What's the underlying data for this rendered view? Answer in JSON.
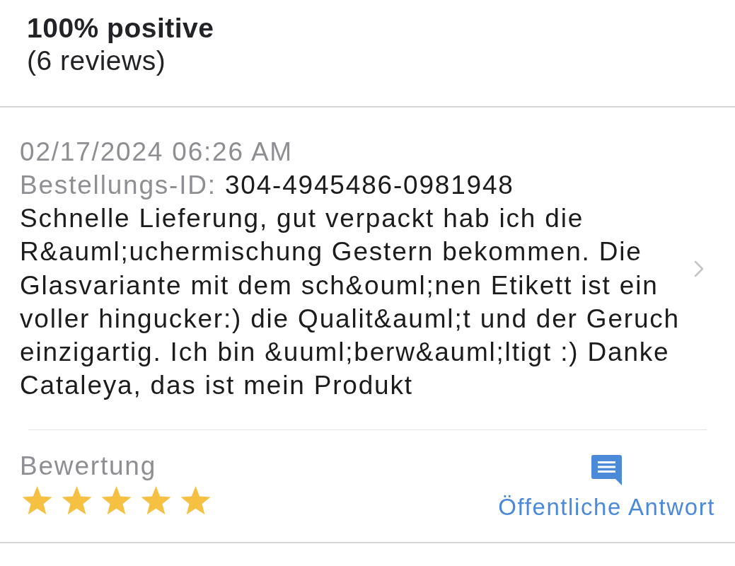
{
  "summary": {
    "rating": "100% positive",
    "count": "(6 reviews)"
  },
  "review": {
    "date": "02/17/2024 06:26 AM",
    "order_label": "Bestellungs-ID:",
    "order_id": "304-4945486-0981948",
    "text": "Schnelle Lieferung, gut verpackt hab ich die R&auml;uchermischung Gestern bekommen. Die Glasvariante mit dem sch&ouml;nen Etikett ist ein voller hingucker:) die Qualit&auml;t und der Geruch einzigartig. Ich bin &uuml;berw&auml;ltigt :) Danke Cataleya, das ist mein Produkt",
    "rating_label": "Bewertung",
    "stars": 5,
    "reply_button": "Öffentliche Antwort"
  }
}
